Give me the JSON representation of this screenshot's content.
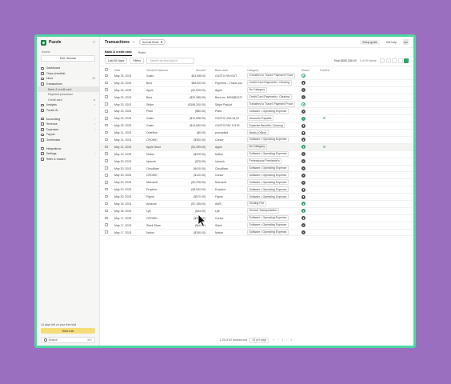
{
  "app": {
    "name": "Puzzle",
    "collapse_glyph": "«"
  },
  "company": {
    "label": "Assets",
    "value": "Edit / Browse"
  },
  "nav": [
    {
      "label": "Dashboard",
      "right": "",
      "sub": false,
      "active": false
    },
    {
      "label": "Close checklist",
      "right": "",
      "sub": false,
      "active": false
    },
    {
      "label": "Inbox",
      "right": "12",
      "sub": false,
      "active": false
    },
    {
      "label": "Transactions",
      "right": "",
      "sub": false,
      "active": false
    },
    {
      "label": "Bank & credit card",
      "right": "",
      "sub": true,
      "active": true
    },
    {
      "label": "Payment processor",
      "right": "",
      "sub": true,
      "active": false
    },
    {
      "label": "Credit card",
      "right": "●",
      "sub": true,
      "active": false
    },
    {
      "label": "Analysis",
      "right": "›",
      "sub": false,
      "active": false
    },
    {
      "label": "Puzzle AI",
      "right": "",
      "sub": false,
      "active": false
    },
    {
      "gap": true
    },
    {
      "label": "Accounting",
      "right": "›",
      "sub": false,
      "active": false
    },
    {
      "label": "Revenue",
      "right": "›",
      "sub": false,
      "active": false
    },
    {
      "label": "Expenses",
      "right": "›",
      "sub": false,
      "active": false
    },
    {
      "label": "Payroll",
      "right": "",
      "sub": false,
      "active": false
    },
    {
      "label": "Overheads",
      "right": "",
      "sub": false,
      "active": false
    },
    {
      "gap": true
    },
    {
      "label": "Integrations",
      "right": "",
      "sub": false,
      "active": false
    },
    {
      "label": "Settings",
      "right": "›",
      "sub": false,
      "active": false
    },
    {
      "label": "Refer & reward",
      "right": "",
      "sub": false,
      "active": false
    }
  ],
  "trial": {
    "text": "14 days left on your free trial",
    "button": "Start trial"
  },
  "side_search": {
    "label": "Search",
    "shortcut": "⌘K"
  },
  "topbar": {
    "title": "Transactions",
    "title_badge": "⇅",
    "accrual": "Accrual Mode",
    "setup_goals": "Setup goals",
    "get_help": "Get help",
    "avatar": "EM"
  },
  "tabs": [
    "Bank & credit card",
    "Rules"
  ],
  "filterbar": {
    "range": "Last 60 days",
    "filters": "Filters",
    "search_placeholder": "Search by description",
    "summary": "Total $850,288.00",
    "pager": "1 of 50 items",
    "prev": "‹",
    "next": "›"
  },
  "columns": [
    "Date",
    "Vendor/Customer",
    "Amount",
    "Bank data",
    "Category",
    "Status",
    "Context"
  ],
  "rows": [
    {
      "date": "May 23, 2023",
      "desc": "Gusto",
      "amount": "$34,595.00",
      "bank": "GUSTO PAYOUT",
      "cat": "Transfers to Travel: Payment Proce",
      "status": "edit",
      "cont": false
    },
    {
      "date": "May 23, 2023",
      "desc": "Brex",
      "amount": "$36,523.00",
      "bank": "Payment – Thank you",
      "cat": "Credit Card Payments • Clearing",
      "status": "check",
      "cont": false
    },
    {
      "date": "May 23, 2023",
      "desc": "Apple",
      "amount": "($1,525.00)",
      "bank": "Apple",
      "cat": "No Category",
      "status": "check",
      "cont": false
    },
    {
      "date": "May 23, 2023",
      "desc": "Brex",
      "amount": "($32,385.00)",
      "bank": "Brex Inc. 8903882127",
      "cat": "Credit Card Payments • Clearing",
      "status": "check",
      "cont": false
    },
    {
      "date": "May 23, 2023",
      "desc": "Stripe",
      "amount": "($155,200.00)",
      "bank": "Stripe Payout",
      "cat": "Transfers to Travel: Payment Proce",
      "status": "edit",
      "cont": false
    },
    {
      "date": "May 23, 2023",
      "desc": "Plaid",
      "amount": "($50.00)",
      "bank": "Plaid",
      "cat": "Software • Operating Expense",
      "status": "check",
      "cont": false
    },
    {
      "date": "May 23, 2023",
      "desc": "Gusto",
      "amount": "($12,558.00)",
      "bank": "GUSTO USA 44,22",
      "cat": "Accounts Payable",
      "status": "pending",
      "cont": true
    },
    {
      "date": "May 23, 2023",
      "desc": "Gusto",
      "amount": "($14,660.00)",
      "bank": "GUSTO PAY 12120",
      "cat": "Expense Benefits: Clearing",
      "status": "check",
      "cont": false
    },
    {
      "date": "May 21, 2023",
      "desc": "Overflow",
      "amount": "($0.00)",
      "bank": "proceplaid",
      "cat": "Meals (Office)",
      "status": "check",
      "cont": false
    },
    {
      "date": "May 21, 2023",
      "desc": "CROWD",
      "amount": "($300.00)",
      "bank": "Cursor",
      "cat": "Software • Operating Expense",
      "status": "check",
      "cont": false
    },
    {
      "date": "May 21, 2023",
      "desc": "Apple Store",
      "amount": "($1,339.00)",
      "bank": "Apple",
      "cat": "No Category",
      "status": "pending",
      "cont": true
    },
    {
      "date": "May 20, 2023",
      "desc": "Notion",
      "amount": "($220.00)",
      "bank": "Notion",
      "cat": "Software • Operating Expense",
      "status": "check",
      "cont": false
    },
    {
      "date": "May 20, 2023",
      "desc": "Upwork",
      "amount": "($75.00)",
      "bank": "Upwork",
      "cat": "Professional Freelance's",
      "status": "check",
      "cont": false
    },
    {
      "date": "May 20, 2023",
      "desc": "Cloudflare",
      "amount": "($410.00)",
      "bank": "Cloudflare",
      "cat": "Software • Operating Expense",
      "status": "check",
      "cont": false
    },
    {
      "date": "May 20, 2023",
      "desc": "CROWD",
      "amount": "($120.00)",
      "bank": "Cursor",
      "cat": "Software • Operating Expense",
      "status": "check",
      "cont": false
    },
    {
      "date": "May 20, 2023",
      "desc": "Microsoft",
      "amount": "($1,226.00)",
      "bank": "Microsoft",
      "cat": "Software • Operating Expense",
      "status": "check",
      "cont": false
    },
    {
      "date": "May 20, 2023",
      "desc": "Dropbox",
      "amount": "($3,000.00)",
      "bank": "Dropbox",
      "cat": "Software • Operating Expense",
      "status": "check",
      "cont": false
    },
    {
      "date": "May 20, 2023",
      "desc": "Figma",
      "amount": "($570.00)",
      "bank": "Figma",
      "cat": "Software • Operating Expense",
      "status": "check",
      "cont": false
    },
    {
      "date": "May 19, 2023",
      "desc": "Amazon",
      "amount": "($7,155.00)",
      "bank": "AWS",
      "cat": "Hosting Fee",
      "status": "pending",
      "cont": false
    },
    {
      "date": "May 18, 2023",
      "desc": "Lyft",
      "amount": "($44.90)",
      "bank": "Lyft",
      "cat": "Ground Transportation",
      "status": "pending",
      "cont": false
    },
    {
      "date": "May 17, 2023",
      "desc": "CROWD",
      "amount": "($380.00)",
      "bank": "Cursor",
      "cat": "Software • Operating Expense",
      "status": "check",
      "cont": false
    },
    {
      "date": "May 17, 2023",
      "desc": "Slack Store",
      "amount": "($80.00)",
      "bank": "Slack",
      "cat": "Software • Operating Expense",
      "status": "check",
      "cont": false
    },
    {
      "date": "May 17, 2023",
      "desc": "Notion",
      "amount": "($250.00)",
      "bank": "Notion",
      "cat": "Software • Operating Expense",
      "status": "check",
      "cont": false
    }
  ],
  "hover_row": 10,
  "footer": {
    "range_text": "1-25 of 52 transactions",
    "per_page": "25 per page",
    "first": "«",
    "prev": "‹",
    "page": "1",
    "next": "›",
    "last": "»"
  },
  "colors": {
    "background": "#9b6fc0",
    "frame": "#4fd6a0",
    "accent": "#2ea66b",
    "trial_button": "#f5dd78"
  }
}
